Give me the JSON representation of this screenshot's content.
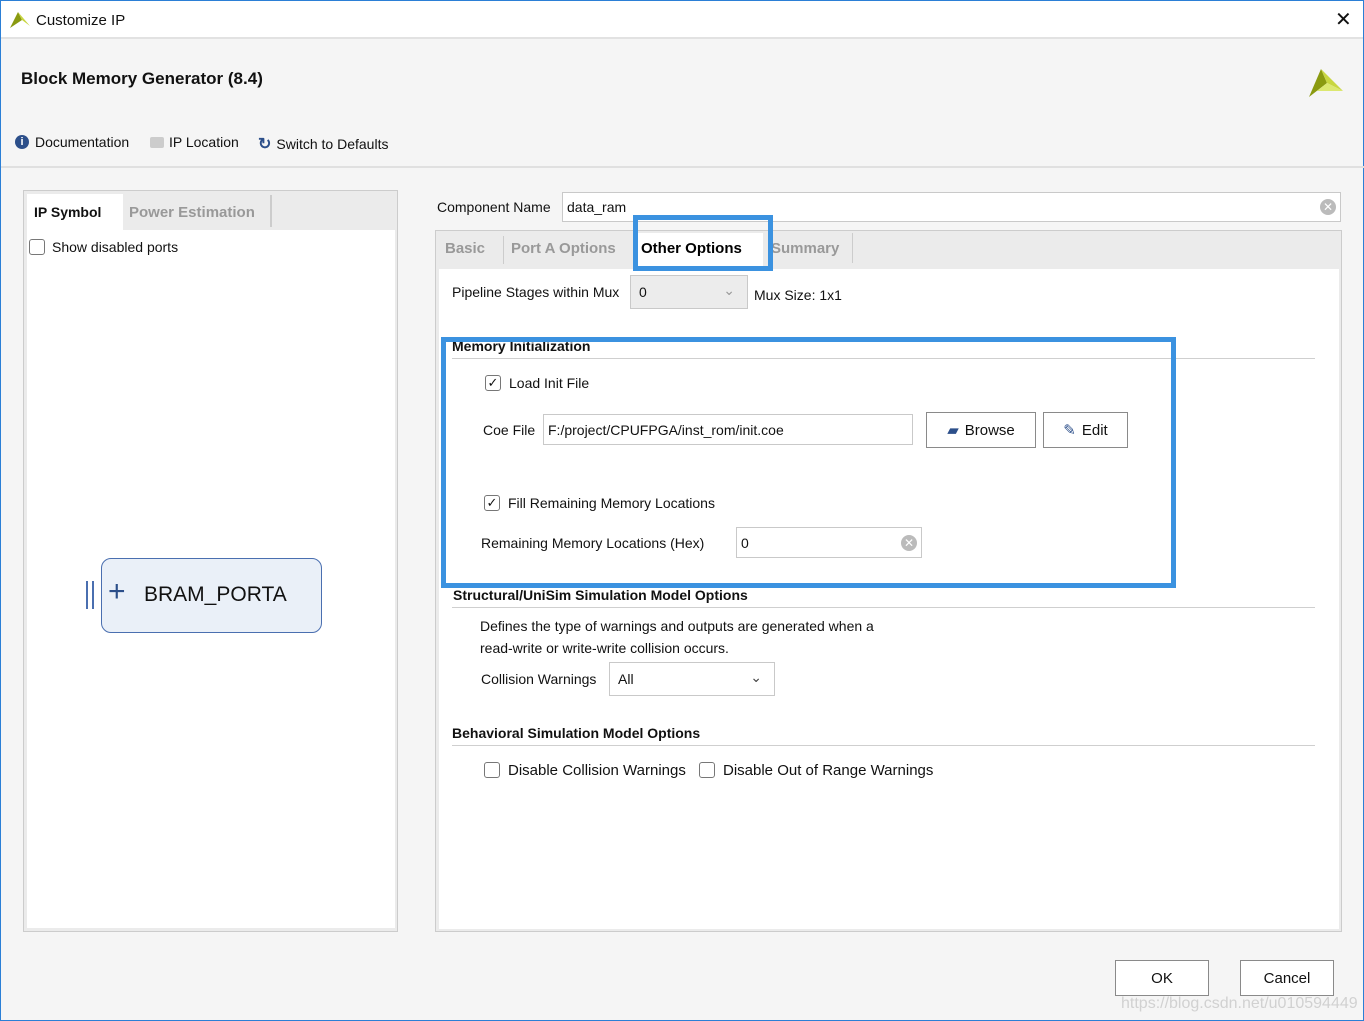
{
  "window": {
    "title": "Customize IP",
    "close_icon": "close-icon"
  },
  "header": {
    "title": "Block Memory Generator (8.4)"
  },
  "toolbar": {
    "documentation": "Documentation",
    "ip_location": "IP Location",
    "switch_defaults": "Switch to Defaults"
  },
  "left": {
    "tabs": [
      "IP Symbol",
      "Power Estimation"
    ],
    "show_disabled": "Show disabled ports",
    "symbol_label": "BRAM_PORTA"
  },
  "component": {
    "label": "Component Name",
    "value": "data_ram"
  },
  "tabs": [
    "Basic",
    "Port A Options",
    "Other Options",
    "Summary"
  ],
  "pipeline": {
    "label": "Pipeline Stages within Mux",
    "value": "0",
    "mux_size": "Mux Size: 1x1"
  },
  "mem_init": {
    "title": "Memory Initialization",
    "load_init": "Load Init File",
    "load_checked": true,
    "coe_label": "Coe File",
    "coe_value": "F:/project/CPUFPGA/inst_rom/init.coe",
    "browse": "Browse",
    "edit": "Edit",
    "fill": "Fill Remaining Memory Locations",
    "fill_checked": true,
    "remaining_label": "Remaining Memory Locations (Hex)",
    "remaining_value": "0"
  },
  "structural": {
    "title": "Structural/UniSim Simulation Model Options",
    "desc1": "Defines the type of warnings and outputs are generated when a",
    "desc2": "read-write or write-write collision occurs.",
    "collision_label": "Collision Warnings",
    "collision_value": "All"
  },
  "behavioral": {
    "title": "Behavioral Simulation Model Options",
    "disable_collision": "Disable Collision Warnings",
    "disable_range": "Disable Out of Range Warnings"
  },
  "footer": {
    "ok": "OK",
    "cancel": "Cancel",
    "watermark": "https://blog.csdn.net/u010594449"
  },
  "colors": {
    "highlight": "#3b92e0",
    "logo": "#a3b81c"
  }
}
